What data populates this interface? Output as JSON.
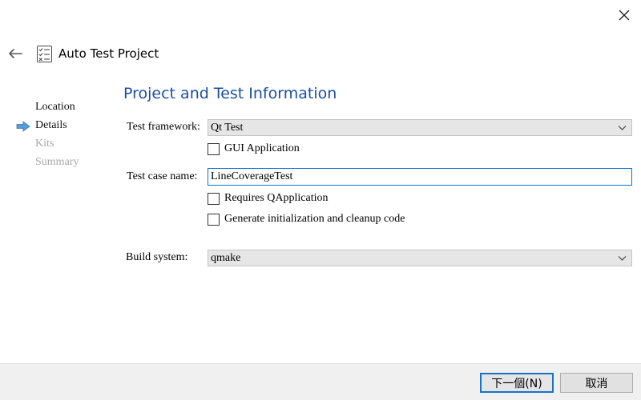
{
  "window": {
    "title": "Auto Test Project",
    "icons": {
      "close": "close-icon",
      "back": "back-arrow-icon",
      "app": "checklist-icon"
    }
  },
  "steps": [
    {
      "label": "Location",
      "state": "done"
    },
    {
      "label": "Details",
      "state": "current"
    },
    {
      "label": "Kits",
      "state": "pending"
    },
    {
      "label": "Summary",
      "state": "pending"
    }
  ],
  "page": {
    "title": "Project and Test Information",
    "test_framework": {
      "label": "Test framework:",
      "value": "Qt Test"
    },
    "gui_application": {
      "label": "GUI Application",
      "checked": false
    },
    "test_case_name": {
      "label": "Test case name:",
      "value": "LineCoverageTest"
    },
    "requires_qapplication": {
      "label": "Requires QApplication",
      "checked": false
    },
    "generate_init_cleanup": {
      "label": "Generate initialization and cleanup code",
      "checked": false
    },
    "build_system": {
      "label": "Build system:",
      "value": "qmake"
    }
  },
  "footer": {
    "next_label": "下一個(N)",
    "cancel_label": "取消"
  },
  "colors": {
    "title_blue": "#1b4fa1",
    "accent_blue": "#1a72c8",
    "current_step_arrow": "#5b9bd5",
    "pending_text": "#a8a8a8"
  }
}
